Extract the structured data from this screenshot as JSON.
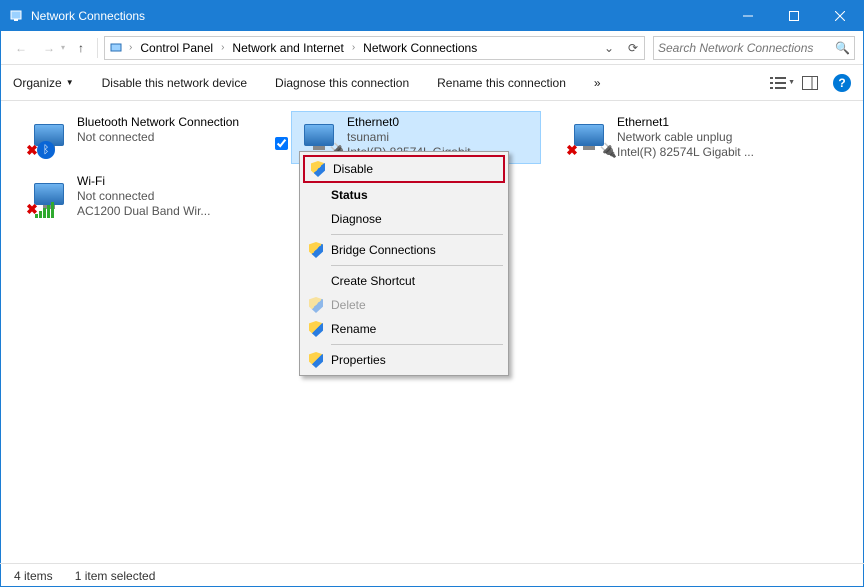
{
  "window": {
    "title": "Network Connections"
  },
  "breadcrumbs": {
    "cp": "Control Panel",
    "net": "Network and Internet",
    "nc": "Network Connections"
  },
  "search": {
    "placeholder": "Search Network Connections"
  },
  "toolbar": {
    "organize": "Organize",
    "disable": "Disable this network device",
    "diagnose": "Diagnose this connection",
    "rename": "Rename this connection",
    "more": "»"
  },
  "connections": {
    "bt": {
      "name": "Bluetooth Network Connection",
      "status": "Not connected",
      "device": ""
    },
    "eth0": {
      "name": "Ethernet0",
      "status": "tsunami",
      "device": "Intel(R) 82574L Gigabit ..."
    },
    "eth1": {
      "name": "Ethernet1",
      "status": "Network cable unplug",
      "device": "Intel(R) 82574L Gigabit ..."
    },
    "wifi": {
      "name": "Wi-Fi",
      "status": "Not connected",
      "device": "AC1200  Dual Band Wir..."
    }
  },
  "context_menu": {
    "disable": "Disable",
    "status": "Status",
    "diagnose": "Diagnose",
    "bridge": "Bridge Connections",
    "shortcut": "Create Shortcut",
    "delete": "Delete",
    "rename": "Rename",
    "properties": "Properties"
  },
  "statusbar": {
    "count": "4 items",
    "selected": "1 item selected"
  },
  "help_glyph": "?"
}
